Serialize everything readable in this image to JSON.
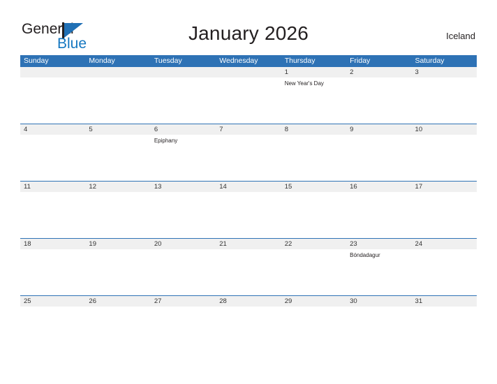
{
  "brand": {
    "name_top": "General",
    "name_bottom": "Blue",
    "accent_color": "#2e72b5",
    "text_color": "#231f20"
  },
  "header": {
    "title": "January 2026",
    "country": "Iceland"
  },
  "calendar": {
    "weekdays": [
      "Sunday",
      "Monday",
      "Tuesday",
      "Wednesday",
      "Thursday",
      "Friday",
      "Saturday"
    ],
    "header_bg": "#2e72b5",
    "date_row_bg": "#f0f0f0",
    "weeks": [
      {
        "days": [
          {
            "num": "",
            "event": ""
          },
          {
            "num": "",
            "event": ""
          },
          {
            "num": "",
            "event": ""
          },
          {
            "num": "",
            "event": ""
          },
          {
            "num": "1",
            "event": "New Year's Day"
          },
          {
            "num": "2",
            "event": ""
          },
          {
            "num": "3",
            "event": ""
          }
        ]
      },
      {
        "days": [
          {
            "num": "4",
            "event": ""
          },
          {
            "num": "5",
            "event": ""
          },
          {
            "num": "6",
            "event": "Epiphany"
          },
          {
            "num": "7",
            "event": ""
          },
          {
            "num": "8",
            "event": ""
          },
          {
            "num": "9",
            "event": ""
          },
          {
            "num": "10",
            "event": ""
          }
        ]
      },
      {
        "days": [
          {
            "num": "11",
            "event": ""
          },
          {
            "num": "12",
            "event": ""
          },
          {
            "num": "13",
            "event": ""
          },
          {
            "num": "14",
            "event": ""
          },
          {
            "num": "15",
            "event": ""
          },
          {
            "num": "16",
            "event": ""
          },
          {
            "num": "17",
            "event": ""
          }
        ]
      },
      {
        "days": [
          {
            "num": "18",
            "event": ""
          },
          {
            "num": "19",
            "event": ""
          },
          {
            "num": "20",
            "event": ""
          },
          {
            "num": "21",
            "event": ""
          },
          {
            "num": "22",
            "event": ""
          },
          {
            "num": "23",
            "event": "Bóndadagur"
          },
          {
            "num": "24",
            "event": ""
          }
        ]
      },
      {
        "days": [
          {
            "num": "25",
            "event": ""
          },
          {
            "num": "26",
            "event": ""
          },
          {
            "num": "27",
            "event": ""
          },
          {
            "num": "28",
            "event": ""
          },
          {
            "num": "29",
            "event": ""
          },
          {
            "num": "30",
            "event": ""
          },
          {
            "num": "31",
            "event": ""
          }
        ]
      }
    ]
  }
}
